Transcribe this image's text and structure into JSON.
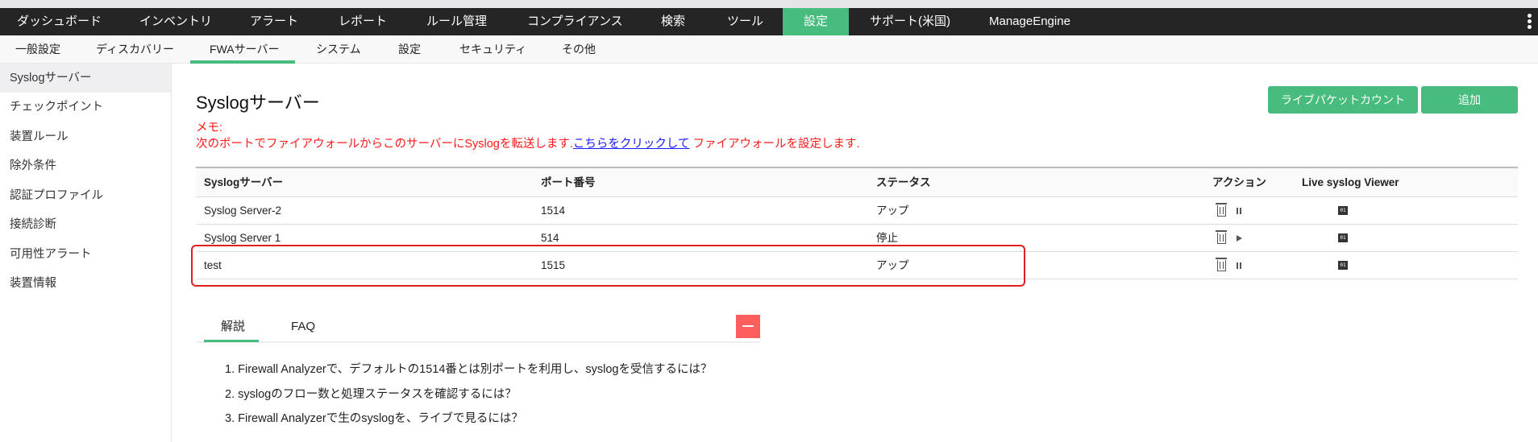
{
  "topnav": {
    "items": [
      "ダッシュボード",
      "インベントリ",
      "アラート",
      "レポート",
      "ルール管理",
      "コンプライアンス",
      "検索",
      "ツール",
      "設定",
      "サポート(米国)",
      "ManageEngine"
    ],
    "active": "設定"
  },
  "subnav": {
    "items": [
      "一般設定",
      "ディスカバリー",
      "FWAサーバー",
      "システム",
      "設定",
      "セキュリティ",
      "その他"
    ],
    "active": "FWAサーバー"
  },
  "sidebar": {
    "items": [
      "Syslogサーバー",
      "チェックポイント",
      "装置ルール",
      "除外条件",
      "認証プロファイル",
      "接続診断",
      "可用性アラート",
      "装置情報"
    ],
    "selected": "Syslogサーバー"
  },
  "page": {
    "title": "Syslogサーバー",
    "memo_label": "メモ:",
    "memo_text_before": "次のポートでファイアウォールからこのサーバーにSyslogを転送します.",
    "memo_link": "こちらをクリックして",
    "memo_text_after": " ファイアウォールを設定します.",
    "buttons": {
      "live_packet": "ライブパケットカウント",
      "add": "追加"
    }
  },
  "table": {
    "headers": [
      "Syslogサーバー",
      "ポート番号",
      "ステータス",
      "アクション",
      "Live syslog Viewer"
    ],
    "rows": [
      {
        "name": "Syslog Server-2",
        "port": "1514",
        "status": "アップ",
        "toggle": "pause"
      },
      {
        "name": "Syslog Server 1",
        "port": "514",
        "status": "停止",
        "toggle": "play"
      },
      {
        "name": "test",
        "port": "1515",
        "status": "アップ",
        "toggle": "pause"
      }
    ]
  },
  "help": {
    "tabs": [
      "解説",
      "FAQ"
    ],
    "active_tab": "解説",
    "items": [
      "1. Firewall Analyzerで、デフォルトの1514番とは別ポートを利用し、syslogを受信するには？",
      "2. syslogのフロー数と処理ステータスを確認するには？",
      "3. Firewall Analyzerで生のsyslogを、ライブで見るには？"
    ]
  },
  "colors": {
    "accent": "#48bb7e",
    "topbar": "#252525",
    "memo": "#ff1a1a",
    "highlight": "#e02020",
    "collapse": "#fe5e5e"
  }
}
